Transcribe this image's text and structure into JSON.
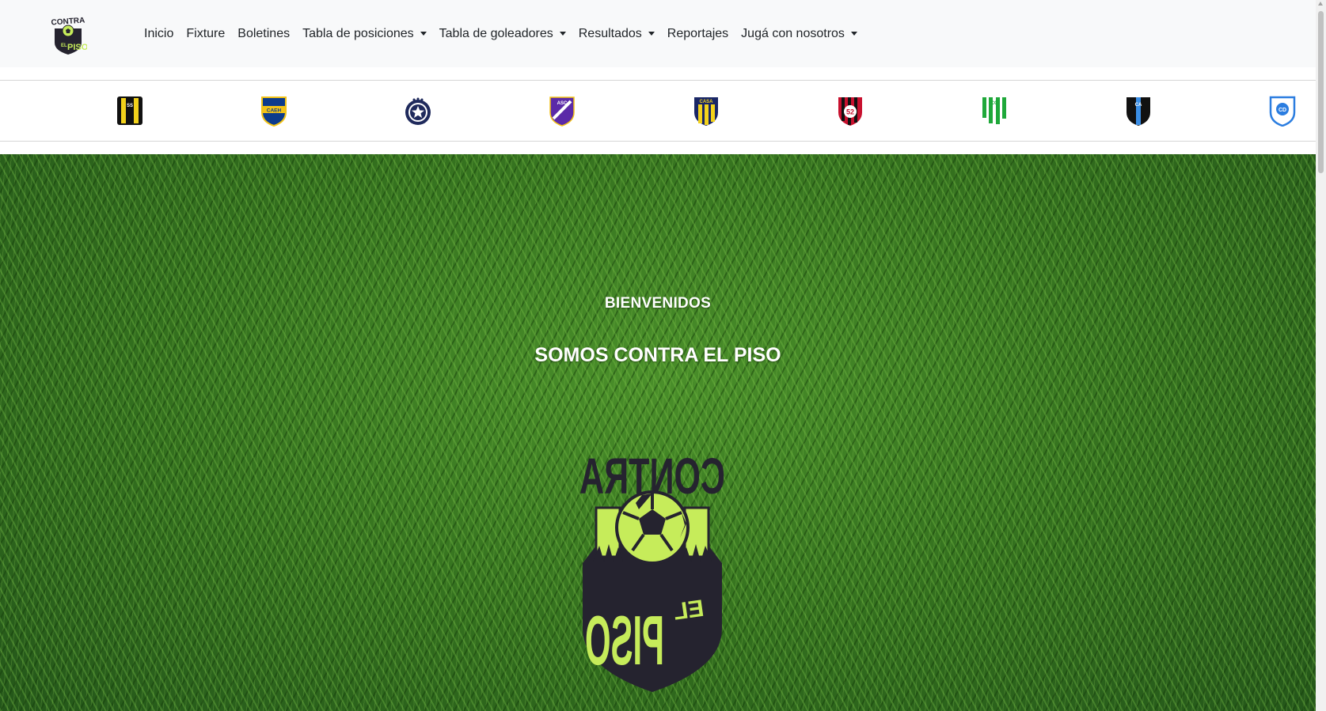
{
  "brand": {
    "logo_text_top": "CONTRA",
    "logo_text_el": "EL",
    "logo_text_bottom": "PISO"
  },
  "nav": {
    "items": [
      {
        "label": "Inicio",
        "dropdown": false
      },
      {
        "label": "Fixture",
        "dropdown": false
      },
      {
        "label": "Boletines",
        "dropdown": false
      },
      {
        "label": "Tabla de posiciones",
        "dropdown": true
      },
      {
        "label": "Tabla de goleadores",
        "dropdown": true
      },
      {
        "label": "Resultados",
        "dropdown": true
      },
      {
        "label": "Reportajes",
        "dropdown": false
      },
      {
        "label": "Jugá con nosotros",
        "dropdown": true
      }
    ]
  },
  "clubs": [
    {
      "icon": "club-crest-black-yellow-stripes",
      "initials": "SS"
    },
    {
      "icon": "club-crest-blue-gold",
      "initials": "CAEH"
    },
    {
      "icon": "club-crest-navy-star",
      "initials": ""
    },
    {
      "icon": "club-crest-purple",
      "initials": "ASC"
    },
    {
      "icon": "club-crest-navy-yellow-stripes",
      "initials": "CASA"
    },
    {
      "icon": "club-crest-red-black",
      "initials": "52"
    },
    {
      "icon": "club-crest-green-white-stripes",
      "initials": "CC"
    },
    {
      "icon": "club-crest-black-blue",
      "initials": "CA"
    },
    {
      "icon": "club-crest-light-blue",
      "initials": "CD"
    }
  ],
  "hero": {
    "welcome": "BIENVENIDOS",
    "title": "SOMOS CONTRA EL PISO",
    "logo_text_top": "CONTRA",
    "logo_text_el": "EL",
    "logo_text_bottom": "PISO"
  },
  "colors": {
    "brand_dark": "#25232f",
    "brand_lime": "#c6ec5a",
    "navbar_bg": "#f8f9fa",
    "grass": "#2f6d1c"
  }
}
